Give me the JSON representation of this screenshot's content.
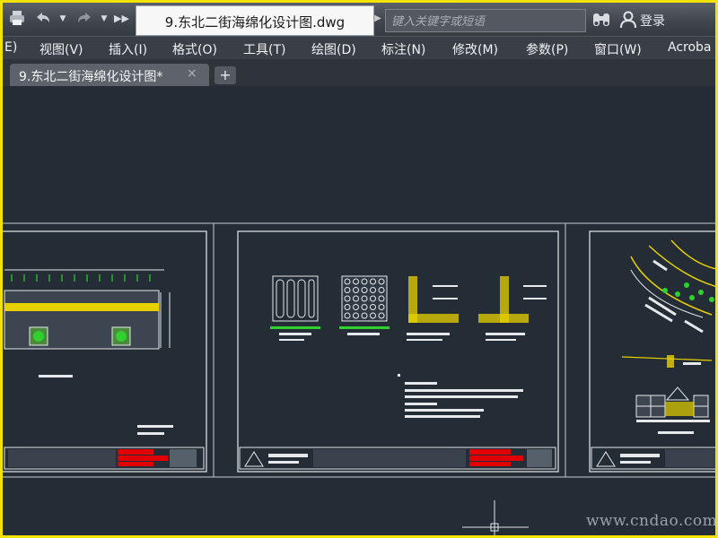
{
  "titlebar": {
    "document_title": "9.东北二街海绵化设计图.dwg",
    "search_placeholder": "键入关键字或短语",
    "login_label": "登录"
  },
  "menu": {
    "items": [
      "E)",
      "视图(V)",
      "插入(I)",
      "格式(O)",
      "工具(T)",
      "绘图(D)",
      "标注(N)",
      "修改(M)",
      "参数(P)",
      "窗口(W)",
      "Acroba"
    ]
  },
  "tabs": {
    "active_label": "9.东北二街海绵化设计图*",
    "close_glyph": "×",
    "add_glyph": "+"
  },
  "icons": {
    "print": "print-icon",
    "undo": "undo-icon",
    "redo": "redo-icon",
    "more": "more-icon",
    "search": "binoculars-icon",
    "user": "user-icon"
  },
  "watermark": "www.cndao.com",
  "colors": {
    "frame_border": "#f4e200",
    "canvas_bg": "#242c35",
    "cad_yellow": "#e8d100",
    "cad_green": "#30d030",
    "cad_red": "#e00000"
  }
}
